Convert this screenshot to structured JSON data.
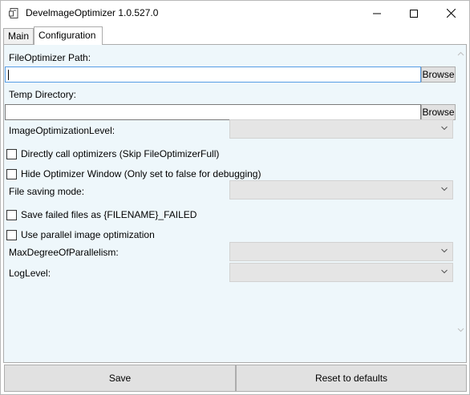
{
  "window": {
    "title": "DevelmageOptimizer 1.0.527.0",
    "icons": {
      "app": "app-icon",
      "minimize": "minimize-icon",
      "maximize": "maximize-icon",
      "close": "close-icon"
    }
  },
  "tabs": [
    {
      "label": "Main",
      "selected": false
    },
    {
      "label": "Configuration",
      "selected": true
    }
  ],
  "config": {
    "file_optimizer_path": {
      "label": "FileOptimizer Path:",
      "value": "",
      "browse_label": "Browse"
    },
    "temp_directory": {
      "label": "Temp Directory:",
      "value": "",
      "browse_label": "Browse"
    },
    "image_optimization_level": {
      "label": "ImageOptimizationLevel:",
      "value": ""
    },
    "direct_call": {
      "label": "Directly call optimizers (Skip FileOptimizerFull)",
      "checked": false
    },
    "hide_window": {
      "label": "Hide Optimizer Window (Only set to false for debugging)",
      "checked": false
    },
    "file_saving_mode": {
      "label": "File saving mode:",
      "value": ""
    },
    "save_failed": {
      "label": "Save failed files as {FILENAME}_FAILED",
      "checked": false
    },
    "parallel": {
      "label": "Use parallel image optimization",
      "checked": false
    },
    "max_degree": {
      "label": "MaxDegreeOfParallelism:",
      "value": ""
    },
    "log_level": {
      "label": "LogLevel:",
      "value": ""
    }
  },
  "buttons": {
    "save": "Save",
    "reset": "Reset to defaults"
  }
}
